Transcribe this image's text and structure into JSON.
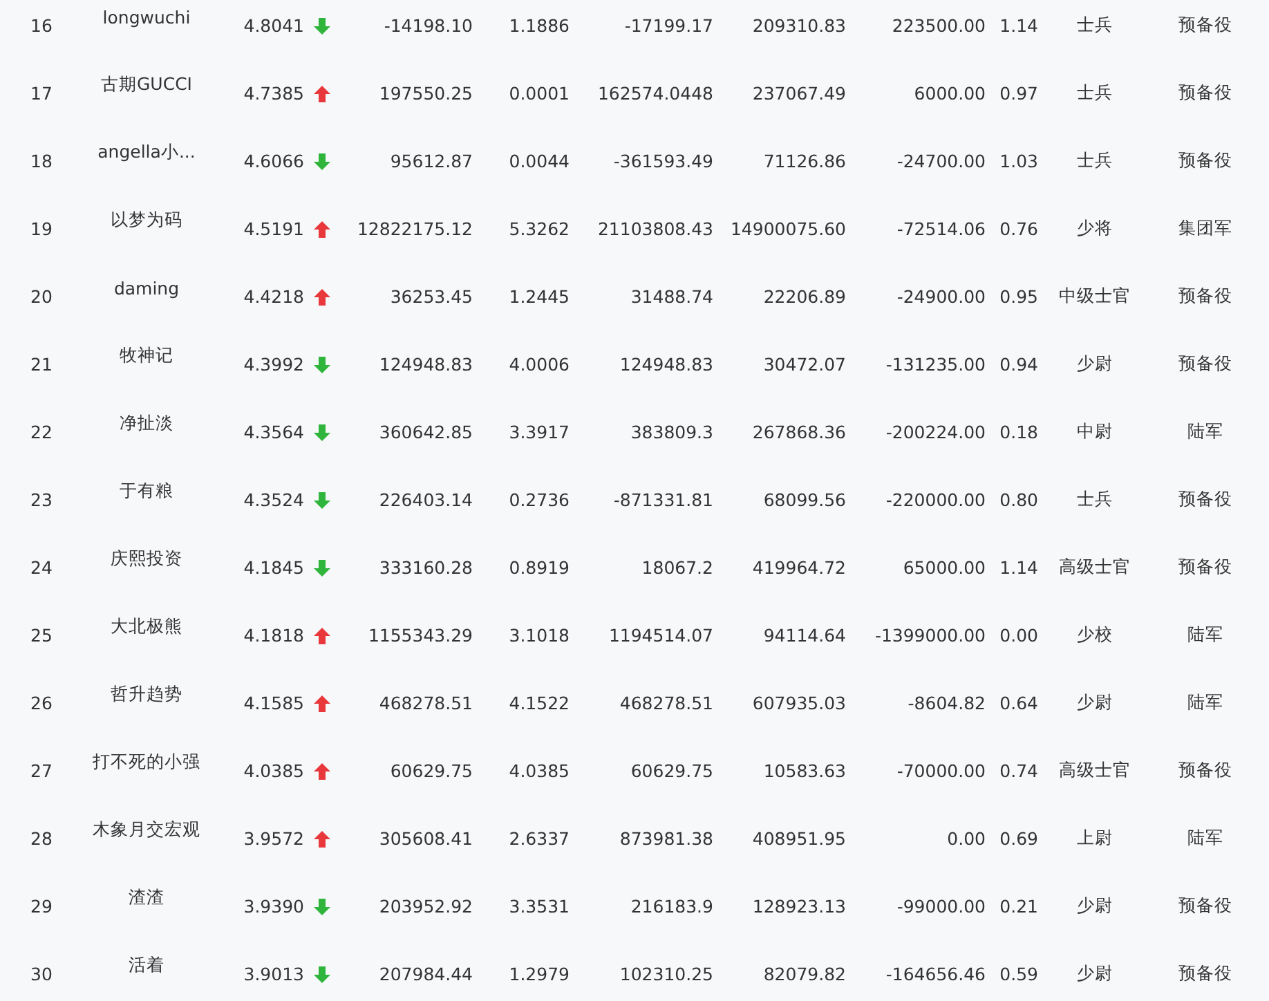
{
  "table": {
    "rows": [
      {
        "rank": "16",
        "name": "longwuchi",
        "score": "4.8041",
        "rising": false,
        "cells": [
          "-14198.10",
          "1.1886",
          "-17199.17",
          "209310.83",
          "223500.00",
          "1.14",
          "士兵",
          "预备役"
        ]
      },
      {
        "rank": "17",
        "name": "古期GUCCI",
        "score": "4.7385",
        "rising": true,
        "cells": [
          "197550.25",
          "0.0001",
          "162574.0448",
          "237067.49",
          "6000.00",
          "0.97",
          "士兵",
          "预备役"
        ]
      },
      {
        "rank": "18",
        "name": "angella小...",
        "score": "4.6066",
        "rising": false,
        "cells": [
          "95612.87",
          "0.0044",
          "-361593.49",
          "71126.86",
          "-24700.00",
          "1.03",
          "士兵",
          "预备役"
        ]
      },
      {
        "rank": "19",
        "name": "以梦为码",
        "score": "4.5191",
        "rising": true,
        "cells": [
          "12822175.12",
          "5.3262",
          "21103808.43",
          "14900075.60",
          "-72514.06",
          "0.76",
          "少将",
          "集团军"
        ]
      },
      {
        "rank": "20",
        "name": "daming",
        "score": "4.4218",
        "rising": true,
        "cells": [
          "36253.45",
          "1.2445",
          "31488.74",
          "22206.89",
          "-24900.00",
          "0.95",
          "中级士官",
          "预备役"
        ]
      },
      {
        "rank": "21",
        "name": "牧神记",
        "score": "4.3992",
        "rising": false,
        "cells": [
          "124948.83",
          "4.0006",
          "124948.83",
          "30472.07",
          "-131235.00",
          "0.94",
          "少尉",
          "预备役"
        ]
      },
      {
        "rank": "22",
        "name": "净扯淡",
        "score": "4.3564",
        "rising": false,
        "cells": [
          "360642.85",
          "3.3917",
          "383809.3",
          "267868.36",
          "-200224.00",
          "0.18",
          "中尉",
          "陆军"
        ]
      },
      {
        "rank": "23",
        "name": "于有粮",
        "score": "4.3524",
        "rising": false,
        "cells": [
          "226403.14",
          "0.2736",
          "-871331.81",
          "68099.56",
          "-220000.00",
          "0.80",
          "士兵",
          "预备役"
        ]
      },
      {
        "rank": "24",
        "name": "庆熙投资",
        "score": "4.1845",
        "rising": false,
        "cells": [
          "333160.28",
          "0.8919",
          "18067.2",
          "419964.72",
          "65000.00",
          "1.14",
          "高级士官",
          "预备役"
        ]
      },
      {
        "rank": "25",
        "name": "大北极熊",
        "score": "4.1818",
        "rising": true,
        "cells": [
          "1155343.29",
          "3.1018",
          "1194514.07",
          "94114.64",
          "-1399000.00",
          "0.00",
          "少校",
          "陆军"
        ]
      },
      {
        "rank": "26",
        "name": "哲升趋势",
        "score": "4.1585",
        "rising": true,
        "cells": [
          "468278.51",
          "4.1522",
          "468278.51",
          "607935.03",
          "-8604.82",
          "0.64",
          "少尉",
          "陆军"
        ]
      },
      {
        "rank": "27",
        "name": "打不死的小强",
        "score": "4.0385",
        "rising": true,
        "cells": [
          "60629.75",
          "4.0385",
          "60629.75",
          "10583.63",
          "-70000.00",
          "0.74",
          "高级士官",
          "预备役"
        ]
      },
      {
        "rank": "28",
        "name": "木象月交宏观",
        "score": "3.9572",
        "rising": true,
        "cells": [
          "305608.41",
          "2.6337",
          "873981.38",
          "408951.95",
          "0.00",
          "0.69",
          "上尉",
          "陆军"
        ]
      },
      {
        "rank": "29",
        "name": "渣渣",
        "score": "3.9390",
        "rising": false,
        "cells": [
          "203952.92",
          "3.3531",
          "216183.9",
          "128923.13",
          "-99000.00",
          "0.21",
          "少尉",
          "预备役"
        ]
      },
      {
        "rank": "30",
        "name": "活着",
        "score": "3.9013",
        "rising": false,
        "cells": [
          "207984.44",
          "1.2979",
          "102310.25",
          "82079.82",
          "-164656.46",
          "0.59",
          "少尉",
          "预备役"
        ]
      }
    ]
  }
}
